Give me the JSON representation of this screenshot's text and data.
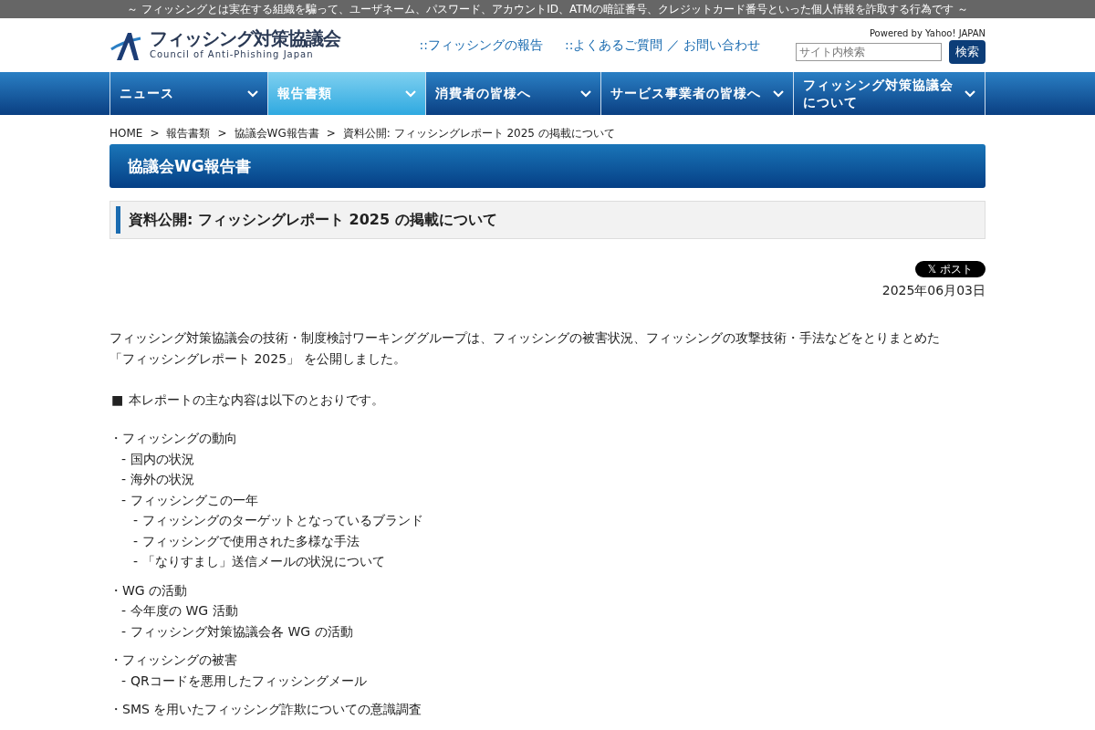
{
  "tagline": "～ フィッシングとは実在する組織を騙って、ユーザネーム、パスワード、アカウントID、ATMの暗証番号、クレジットカード番号といった個人情報を詐取する行為です ～",
  "logo": {
    "title": "フィッシング対策協議会",
    "subtitle": "Council of Anti-Phishing Japan"
  },
  "header_links": [
    {
      "marker": "::",
      "text": "フィッシングの報告"
    },
    {
      "marker": "::",
      "text": "よくあるご質問 ／ お問い合わせ"
    }
  ],
  "search": {
    "powered_by": "Powered by Yahoo! JAPAN",
    "placeholder": "サイト内検索",
    "button": "検索"
  },
  "nav": [
    {
      "label": "ニュース",
      "selected": false
    },
    {
      "label": "報告書類",
      "selected": true
    },
    {
      "label": "消費者の皆様へ",
      "selected": false
    },
    {
      "label": "サービス事業者の皆様へ",
      "selected": false
    },
    {
      "label": "フィッシング対策協議会について",
      "selected": false
    }
  ],
  "breadcrumb": [
    {
      "text": "HOME"
    },
    {
      "text": "報告書類"
    },
    {
      "text": "協議会WG報告書"
    },
    {
      "text": "資料公開: フィッシングレポート 2025 の掲載について"
    }
  ],
  "breadcrumb_separator": ">",
  "section_title": "協議会WG報告書",
  "article_title": "資料公開: フィッシングレポート 2025 の掲載について",
  "share_button": {
    "icon": "𝕏",
    "label": "ポスト"
  },
  "date": "2025年06月03日",
  "intro": [
    "フィッシング対策協議会の技術・制度検討ワーキンググループは、フィッシングの被害状況、フィッシングの攻撃技術・手法などをとりまとめた",
    "「フィッシングレポート 2025」 を公開しました。"
  ],
  "lead": {
    "marker": "■",
    "text": "本レポートの主な内容は以下のとおりです。"
  },
  "outline": [
    {
      "marker": "・",
      "text": "フィッシングの動向",
      "children": [
        {
          "marker": "-",
          "text": "国内の状況"
        },
        {
          "marker": "-",
          "text": "海外の状況"
        },
        {
          "marker": "-",
          "text": "フィッシングこの一年",
          "children": [
            {
              "marker": "-",
              "text": "フィッシングのターゲットとなっているブランド"
            },
            {
              "marker": "-",
              "text": "フィッシングで使用された多様な手法"
            },
            {
              "marker": "-",
              "text": "「なりすまし」送信メールの状況について"
            }
          ]
        }
      ]
    },
    {
      "marker": "・",
      "text": "WG の活動",
      "children": [
        {
          "marker": "-",
          "text": "今年度の WG 活動"
        },
        {
          "marker": "-",
          "text": "フィッシング対策協議会各 WG の活動"
        }
      ]
    },
    {
      "marker": "・",
      "text": "フィッシングの被害",
      "children": [
        {
          "marker": "-",
          "text": "QRコードを悪用したフィッシングメール"
        }
      ]
    },
    {
      "marker": "・",
      "text": "SMS を用いたフィッシング詐欺についての意識調査"
    }
  ]
}
